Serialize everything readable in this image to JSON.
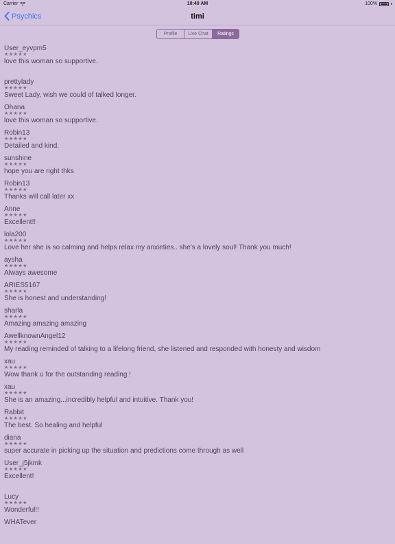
{
  "status_bar": {
    "carrier": "Carrier",
    "time": "10:40 AM",
    "battery": "100%"
  },
  "nav": {
    "back_label": "Psychics",
    "title": "timi"
  },
  "segments": [
    {
      "label": "Profile"
    },
    {
      "label": "Live Chat"
    },
    {
      "label": "Ratings"
    }
  ],
  "reviews": [
    {
      "user": "User_eyvpm5",
      "stars": "★★★★★",
      "text": "love this woman so supportive."
    },
    {
      "user": "prettylady",
      "stars": "★★★★★",
      "text": "Sweet Lady, wish we could of talked longer."
    },
    {
      "user": "Ohana",
      "stars": "★★★★★",
      "text": "love this woman so supportive."
    },
    {
      "user": "Robin13",
      "stars": "★★★★★",
      "text": "Detailed and kind."
    },
    {
      "user": "sunshine",
      "stars": "★★★★★",
      "text": "hope you are right thks"
    },
    {
      "user": "Robin13",
      "stars": "★★★★★",
      "text": "Thanks will call later xx"
    },
    {
      "user": "Anne",
      "stars": "★★★★★",
      "text": "Excellent!!"
    },
    {
      "user": "lola200",
      "stars": "★★★★★",
      "text": "Love her she is so calming and helps relax my anxieties.. she's a lovely soul! Thank you much!"
    },
    {
      "user": "aysha",
      "stars": "★★★★★",
      "text": "Always awesome"
    },
    {
      "user": "ARIES5167",
      "stars": "★★★★★",
      "text": "She is honest and understanding!"
    },
    {
      "user": "sharla",
      "stars": "★★★★★",
      "text": "Amazing amazing amazing"
    },
    {
      "user": "AwellknownAngel12",
      "stars": "★★★★★",
      "text": "My reading reminded of talking to a lifelong friend, she listened and responded with honesty and wisdom"
    },
    {
      "user": "xau",
      "stars": "★★★★★",
      "text": "Wow thank u for the outstanding reading !"
    },
    {
      "user": "xau",
      "stars": "★★★★★",
      "text": "She is an amazing...incredibly helpful and intuitive. Thank you!"
    },
    {
      "user": "Rabbit",
      "stars": "★★★★★",
      "text": "The best. So healing and helpful"
    },
    {
      "user": "diana",
      "stars": "★★★★★",
      "text": "super accurate in picking up the situation and predictions come through as well"
    },
    {
      "user": "User_j5jkmk",
      "stars": "★★★★★",
      "text": "Excellent!"
    },
    {
      "user": "Lucy",
      "stars": "★★★★★",
      "text": "Wonderful!!"
    },
    {
      "user": "WHATever",
      "stars": "",
      "text": ""
    }
  ]
}
